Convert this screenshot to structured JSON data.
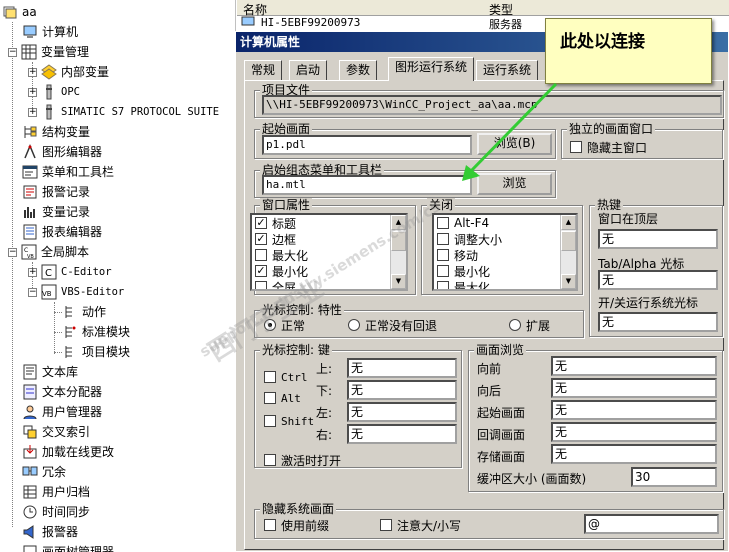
{
  "tree": {
    "root": "aa",
    "items": [
      {
        "label": "计算机",
        "icon": "computer-icon"
      },
      {
        "label": "变量管理",
        "icon": "tag-management-icon"
      },
      {
        "label": "内部变量",
        "icon": "internal-tags-icon"
      },
      {
        "label": "OPC",
        "icon": "opc-driver-icon"
      },
      {
        "label": "SIMATIC S7 PROTOCOL SUITE",
        "icon": "s7-driver-icon"
      },
      {
        "label": "结构变量",
        "icon": "structure-tag-icon"
      },
      {
        "label": "图形编辑器",
        "icon": "graphics-designer-icon"
      },
      {
        "label": "菜单和工具栏",
        "icon": "menus-toolbars-icon"
      },
      {
        "label": "报警记录",
        "icon": "alarm-logging-icon"
      },
      {
        "label": "变量记录",
        "icon": "tag-logging-icon"
      },
      {
        "label": "报表编辑器",
        "icon": "report-designer-icon"
      },
      {
        "label": "全局脚本",
        "icon": "global-script-icon"
      },
      {
        "label": "C-Editor",
        "icon": "c-editor-icon"
      },
      {
        "label": "VBS-Editor",
        "icon": "vbs-editor-icon"
      },
      {
        "label": "动作",
        "icon": "action-icon"
      },
      {
        "label": "标准模块",
        "icon": "standard-module-icon"
      },
      {
        "label": "项目模块",
        "icon": "project-module-icon"
      },
      {
        "label": "文本库",
        "icon": "text-library-icon"
      },
      {
        "label": "文本分配器",
        "icon": "text-distributor-icon"
      },
      {
        "label": "用户管理器",
        "icon": "user-admin-icon"
      },
      {
        "label": "交叉索引",
        "icon": "cross-reference-icon"
      },
      {
        "label": "加载在线更改",
        "icon": "load-online-changes-icon"
      },
      {
        "label": "冗余",
        "icon": "redundancy-icon"
      },
      {
        "label": "用户归档",
        "icon": "user-archive-icon"
      },
      {
        "label": "时间同步",
        "icon": "time-sync-icon"
      },
      {
        "label": "报警器",
        "icon": "horn-icon"
      },
      {
        "label": "画面树管理器",
        "icon": "picture-tree-icon"
      }
    ]
  },
  "list": {
    "col_name": "名称",
    "col_type": "类型",
    "row_name": "HI-5EBF99200973",
    "row_type": "服务器"
  },
  "dialog": {
    "title": "计算机属性",
    "tabs": [
      "常规",
      "启动",
      "参数",
      "图形运行系统",
      "运行系统"
    ],
    "project_file_label": "项目文件",
    "project_file_value": "\\\\HI-5EBF99200973\\WinCC_Project_aa\\aa.mcp",
    "start_picture_label": "起始画面",
    "start_picture_value": "p1.pdl",
    "browse_label_accel": "浏览(B)",
    "browse_label": "浏览",
    "independent_window_label": "独立的画面窗口",
    "hide_main_window": "隐藏主窗口",
    "start_menu_label": "启始组态菜单和工具栏",
    "start_menu_value": "ha.mtl",
    "window_attrs_label": "窗口属性",
    "window_attrs": [
      {
        "label": "标题",
        "checked": true
      },
      {
        "label": "边框",
        "checked": true
      },
      {
        "label": "最大化",
        "checked": false
      },
      {
        "label": "最小化",
        "checked": true
      },
      {
        "label": "全屏",
        "checked": false
      }
    ],
    "close_label": "关闭",
    "close_items": [
      {
        "label": "Alt-F4",
        "checked": false
      },
      {
        "label": "调整大小",
        "checked": false
      },
      {
        "label": "移动",
        "checked": false
      },
      {
        "label": "最小化",
        "checked": false
      },
      {
        "label": "最大化",
        "checked": false
      }
    ],
    "hotkeys_label": "热键",
    "window_on_top_label": "窗口在顶层",
    "window_on_top_value": "无",
    "tab_alpha_label": "Tab/Alpha 光标",
    "tab_alpha_value": "无",
    "toggle_runtime_label": "开/关运行系统光标",
    "toggle_runtime_value": "无",
    "cursor_control_label": "光标控制: 特性",
    "radio_normal": "正常",
    "radio_normal_noreturn": "正常没有回退",
    "radio_extended": "扩展",
    "cursor_keys_label": "光标控制: 键",
    "ctrl_label": "Ctrl",
    "alt_label": "Alt",
    "shift_label": "Shift",
    "up_label": "上:",
    "down_label": "下:",
    "left_label": "左:",
    "right_label": "右:",
    "up_value": "无",
    "down_value": "无",
    "left_value": "无",
    "right_value": "无",
    "activate_on_open": "激活时打开",
    "picture_nav_label": "画面浏览",
    "forward_label": "向前",
    "forward_value": "无",
    "backward_label": "向后",
    "backward_value": "无",
    "start_pic_label": "起始画面",
    "start_pic_value": "无",
    "recall_label": "回调画面",
    "recall_value": "无",
    "store_label": "存储画面",
    "store_value": "无",
    "buffer_label": "缓冲区大小 (画面数)",
    "buffer_value": "30",
    "hidden_pics_label": "隐藏系统画面",
    "use_prefix": "使用前缀",
    "case_sensitive": "注意大/小写",
    "prefix_value": "@"
  },
  "annotation": {
    "text": "此处以连接",
    "color": "#33cc33"
  },
  "watermark": {
    "cn": "西门子工业",
    "en": "support.industry.siemens.com/cs"
  }
}
